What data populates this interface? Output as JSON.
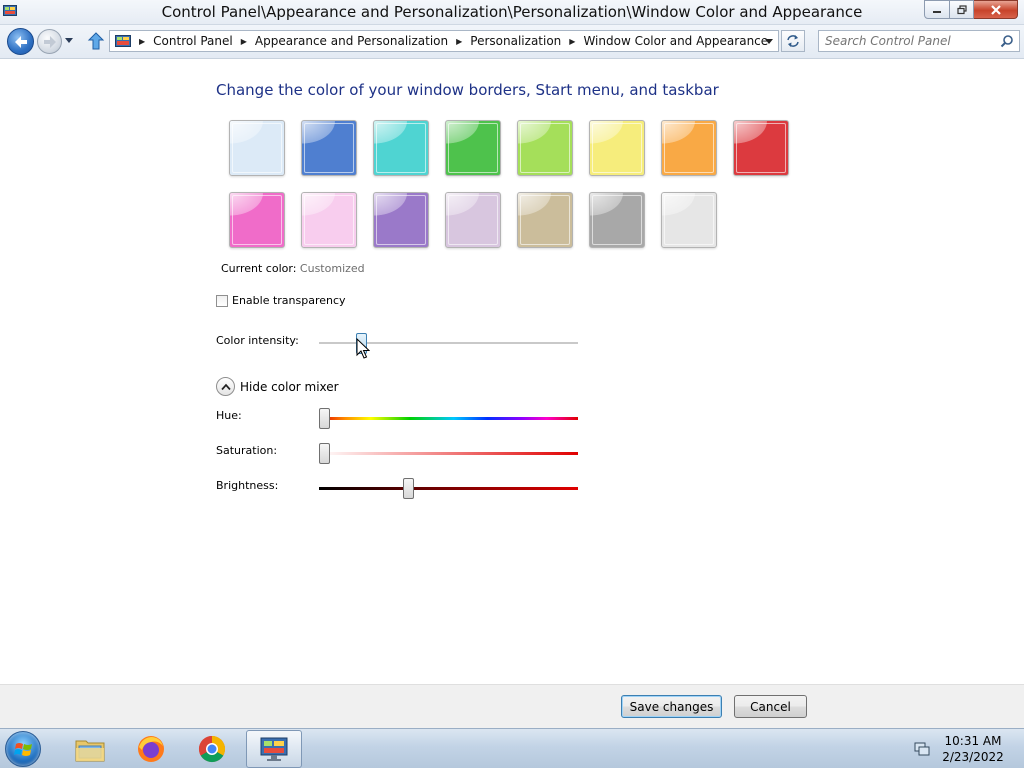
{
  "window": {
    "title": "Control Panel\\Appearance and Personalization\\Personalization\\Window Color and Appearance"
  },
  "nav": {
    "breadcrumbs": [
      "Control Panel",
      "Appearance and Personalization",
      "Personalization",
      "Window Color and Appearance"
    ],
    "search_placeholder": "Search Control Panel"
  },
  "content": {
    "heading": "Change the color of your window borders, Start menu, and taskbar",
    "swatches": [
      {
        "name": "sky",
        "color": "#dceaf7"
      },
      {
        "name": "twilight",
        "color": "#4f7fd0"
      },
      {
        "name": "sea",
        "color": "#4fd4d2"
      },
      {
        "name": "leaf",
        "color": "#4ec24c"
      },
      {
        "name": "lime",
        "color": "#a5df5a"
      },
      {
        "name": "lemon",
        "color": "#f6ed7c"
      },
      {
        "name": "pumpkin",
        "color": "#f9a945"
      },
      {
        "name": "ruby",
        "color": "#dc3a3f"
      },
      {
        "name": "fuchsia",
        "color": "#f06cc9"
      },
      {
        "name": "blush",
        "color": "#f8cdee"
      },
      {
        "name": "violet",
        "color": "#9a79c9"
      },
      {
        "name": "lavender",
        "color": "#d8c6df"
      },
      {
        "name": "taupe",
        "color": "#cbbd9b"
      },
      {
        "name": "chocolate",
        "color": "#a8a8a8"
      },
      {
        "name": "slate",
        "color": "#e6e6e6"
      }
    ],
    "current_color_label": "Current color:",
    "current_color_value": "Customized",
    "transparency_label": "Enable transparency",
    "transparency_checked": false,
    "intensity_label": "Color intensity:",
    "intensity_value": 0.15,
    "mixer_toggle_label": "Hide color mixer",
    "hue_label": "Hue:",
    "hue_value": 0.0,
    "saturation_label": "Saturation:",
    "saturation_value": 0.0,
    "brightness_label": "Brightness:",
    "brightness_value": 0.34
  },
  "footer": {
    "save_label": "Save changes",
    "cancel_label": "Cancel"
  },
  "taskbar": {
    "apps": [
      "explorer",
      "firefox",
      "chrome",
      "control-panel"
    ],
    "time": "10:31 AM",
    "date": "2/23/2022"
  },
  "colors": {
    "heading": "#1e3287",
    "accent": "#3c7fb1"
  }
}
